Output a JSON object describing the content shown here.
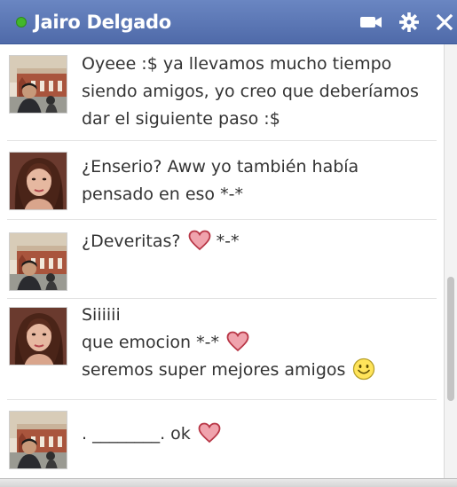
{
  "header": {
    "contact_name": "Jairo Delgado",
    "colors": {
      "bar": "#5872b0",
      "online": "#42b72a"
    },
    "icons": [
      "video-camera-icon",
      "gear-icon",
      "close-icon"
    ]
  },
  "messages": [
    {
      "sender": "Jairo Delgado",
      "avatar": "male-avatar",
      "lines": [
        "Oyeee :$ ya llevamos mucho tiempo",
        "siendo amigos, yo creo que deberíamos",
        "dar el siguiente paso :$"
      ]
    },
    {
      "sender": "female",
      "avatar": "female-avatar",
      "lines": [
        "¿Enserio? Aww yo también había",
        "pensado en eso *-*"
      ]
    },
    {
      "sender": "Jairo Delgado",
      "avatar": "male-avatar",
      "lines": [
        "¿Deveritas?",
        "*-*"
      ],
      "emoticons": [
        "heart-icon"
      ]
    },
    {
      "sender": "female",
      "avatar": "female-avatar",
      "lines": [
        "Siiiiii",
        "que emocion *-*",
        "seremos super mejores amigos"
      ],
      "emoticons": [
        "heart-icon",
        "smiley-icon"
      ]
    },
    {
      "sender": "Jairo Delgado",
      "avatar": "male-avatar",
      "lines": [
        ". ________. ok"
      ],
      "emoticons": [
        "heart-icon"
      ]
    }
  ]
}
